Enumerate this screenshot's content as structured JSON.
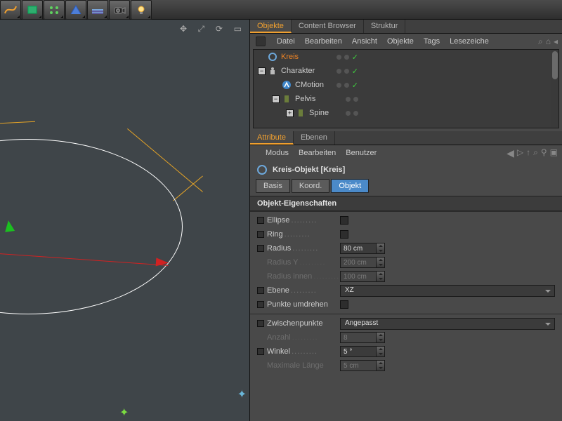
{
  "toolbar": {
    "icons": [
      "spline-icon",
      "cube-icon",
      "array-icon",
      "boolean-icon",
      "floor-icon",
      "camera-icon",
      "light-icon"
    ]
  },
  "right_tabs": {
    "objects": "Objekte",
    "content_browser": "Content Browser",
    "struktur": "Struktur"
  },
  "objects_menu": {
    "datei": "Datei",
    "bearbeiten": "Bearbeiten",
    "ansicht": "Ansicht",
    "objekte": "Objekte",
    "tags": "Tags",
    "lesezeichen": "Lesezeiche"
  },
  "tree": {
    "kreis": "Kreis",
    "charakter": "Charakter",
    "cmotion": "CMotion",
    "pelvis": "Pelvis",
    "spine": "Spine"
  },
  "attr_tabs": {
    "attribute": "Attribute",
    "ebenen": "Ebenen"
  },
  "attr_menu": {
    "modus": "Modus",
    "bearbeiten": "Bearbeiten",
    "benutzer": "Benutzer"
  },
  "attr_title": "Kreis-Objekt [Kreis]",
  "sub_tabs": {
    "basis": "Basis",
    "koord": "Koord.",
    "objekt": "Objekt"
  },
  "section": "Objekt-Eigenschaften",
  "props": {
    "ellipse": "Ellipse",
    "ring": "Ring",
    "radius_label": "Radius",
    "radius_value": "80 cm",
    "radius_y_label": "Radius Y",
    "radius_y_value": "200 cm",
    "radius_innen_label": "Radius innen",
    "radius_innen_value": "100 cm",
    "ebene_label": "Ebene",
    "ebene_value": "XZ",
    "punkte_label": "Punkte umdrehen",
    "zwischen_label": "Zwischenpunkte",
    "zwischen_value": "Angepasst",
    "anzahl_label": "Anzahl",
    "anzahl_value": "8",
    "winkel_label": "Winkel",
    "winkel_value": "5 °",
    "maxlen_label": "Maximale Länge",
    "maxlen_value": "5 cm"
  }
}
